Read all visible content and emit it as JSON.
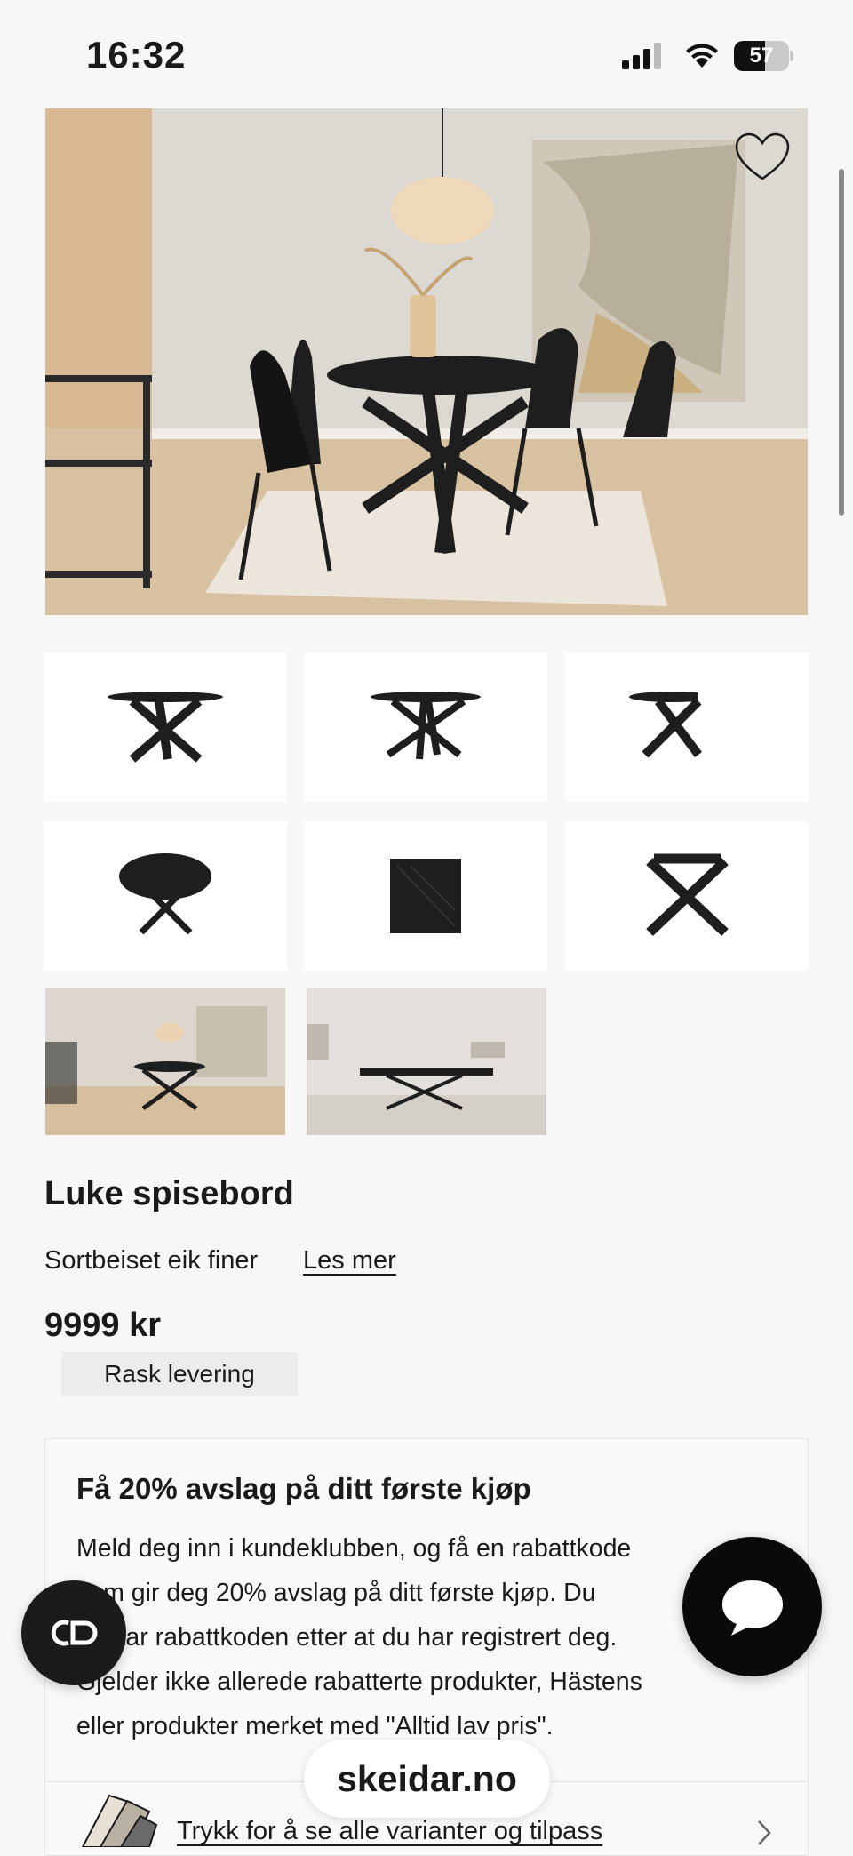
{
  "status_bar": {
    "time": "16:32",
    "battery": "57"
  },
  "product": {
    "name": "Luke spisebord",
    "material": "Sortbeiset eik finer",
    "read_more": "Les mer",
    "price": "9999 kr",
    "badge": "Rask levering"
  },
  "promo": {
    "title": "Få 20% avslag på ditt første kjøp",
    "lines": [
      "Meld deg inn i kundeklubben, og få en rabattkode",
      "som gir deg 20% avslag på ditt første kjøp. Du",
      "mottar rabattkoden etter at du har registrert deg.",
      "Gjelder ikke allerede rabatterte produkter, Hästens",
      "eller produkter merket med \"Alltid lav pris\"."
    ]
  },
  "variants_link": "Trykk for å se alle varianter og tilpass",
  "site_pill": "skeidar.no",
  "icons": {
    "favorite": "heart-icon",
    "compare": "compare-icon",
    "chat": "chat-bubble-icon",
    "swatches": "fabric-swatch-icon",
    "chevron": "chevron-right-icon"
  },
  "colors": {
    "background": "#f7f7f7",
    "text": "#1a1a1a",
    "badge": "#ececec",
    "fab": "#0a0a0a"
  }
}
